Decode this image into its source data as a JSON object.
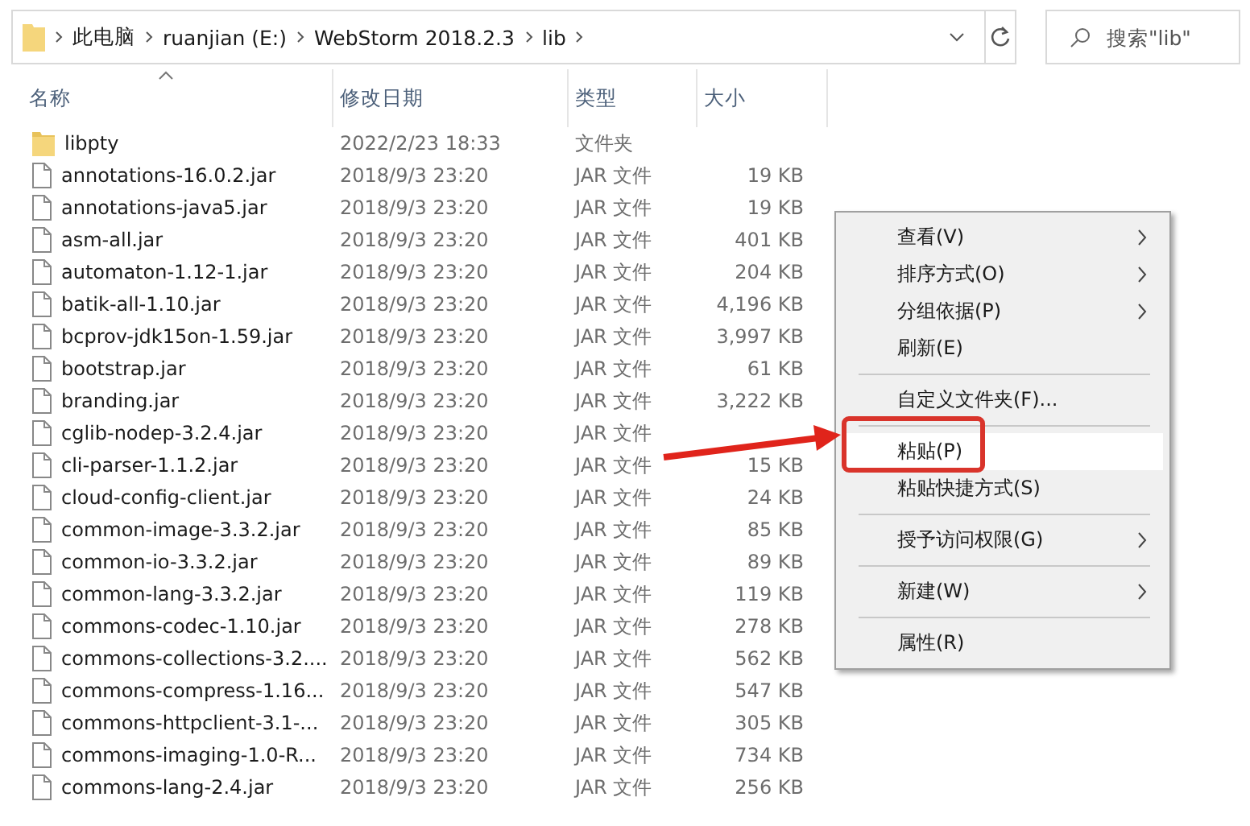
{
  "address_bar": {
    "crumbs": [
      "此电脑",
      "ruanjian (E:)",
      "WebStorm 2018.2.3",
      "lib"
    ]
  },
  "search": {
    "placeholder": "搜索\"lib\""
  },
  "columns": [
    {
      "label": "名称",
      "sorted": true
    },
    {
      "label": "修改日期",
      "sorted": false
    },
    {
      "label": "类型",
      "sorted": false
    },
    {
      "label": "大小",
      "sorted": false
    }
  ],
  "files": [
    {
      "kind": "folder",
      "name": "libpty",
      "date": "2022/2/23 18:33",
      "type": "文件夹"
    },
    {
      "kind": "file",
      "name": "annotations-16.0.2.jar",
      "date": "2018/9/3 23:20",
      "type": "JAR 文件",
      "size": "19 KB"
    },
    {
      "kind": "file",
      "name": "annotations-java5.jar",
      "date": "2018/9/3 23:20",
      "type": "JAR 文件",
      "size": "19 KB"
    },
    {
      "kind": "file",
      "name": "asm-all.jar",
      "date": "2018/9/3 23:20",
      "type": "JAR 文件",
      "size": "401 KB"
    },
    {
      "kind": "file",
      "name": "automaton-1.12-1.jar",
      "date": "2018/9/3 23:20",
      "type": "JAR 文件",
      "size": "204 KB"
    },
    {
      "kind": "file",
      "name": "batik-all-1.10.jar",
      "date": "2018/9/3 23:20",
      "type": "JAR 文件",
      "size": "4,196 KB"
    },
    {
      "kind": "file",
      "name": "bcprov-jdk15on-1.59.jar",
      "date": "2018/9/3 23:20",
      "type": "JAR 文件",
      "size": "3,997 KB"
    },
    {
      "kind": "file",
      "name": "bootstrap.jar",
      "date": "2018/9/3 23:20",
      "type": "JAR 文件",
      "size": "61 KB"
    },
    {
      "kind": "file",
      "name": "branding.jar",
      "date": "2018/9/3 23:20",
      "type": "JAR 文件",
      "size": "3,222 KB"
    },
    {
      "kind": "file",
      "name": "cglib-nodep-3.2.4.jar",
      "date": "2018/9/3 23:20",
      "type": "JAR 文件"
    },
    {
      "kind": "file",
      "name": "cli-parser-1.1.2.jar",
      "date": "2018/9/3 23:20",
      "type": "JAR 文件",
      "size": "15 KB"
    },
    {
      "kind": "file",
      "name": "cloud-config-client.jar",
      "date": "2018/9/3 23:20",
      "type": "JAR 文件",
      "size": "24 KB"
    },
    {
      "kind": "file",
      "name": "common-image-3.3.2.jar",
      "date": "2018/9/3 23:20",
      "type": "JAR 文件",
      "size": "85 KB"
    },
    {
      "kind": "file",
      "name": "common-io-3.3.2.jar",
      "date": "2018/9/3 23:20",
      "type": "JAR 文件",
      "size": "89 KB"
    },
    {
      "kind": "file",
      "name": "common-lang-3.3.2.jar",
      "date": "2018/9/3 23:20",
      "type": "JAR 文件",
      "size": "119 KB"
    },
    {
      "kind": "file",
      "name": "commons-codec-1.10.jar",
      "date": "2018/9/3 23:20",
      "type": "JAR 文件",
      "size": "278 KB"
    },
    {
      "kind": "file",
      "name": "commons-collections-3.2....",
      "date": "2018/9/3 23:20",
      "type": "JAR 文件",
      "size": "562 KB"
    },
    {
      "kind": "file",
      "name": "commons-compress-1.16...",
      "date": "2018/9/3 23:20",
      "type": "JAR 文件",
      "size": "547 KB"
    },
    {
      "kind": "file",
      "name": "commons-httpclient-3.1-...",
      "date": "2018/9/3 23:20",
      "type": "JAR 文件",
      "size": "305 KB"
    },
    {
      "kind": "file",
      "name": "commons-imaging-1.0-R...",
      "date": "2018/9/3 23:20",
      "type": "JAR 文件",
      "size": "734 KB"
    },
    {
      "kind": "file",
      "name": "commons-lang-2.4.jar",
      "date": "2018/9/3 23:20",
      "type": "JAR 文件",
      "size": "256 KB"
    }
  ],
  "context_menu": [
    {
      "kind": "item",
      "label": "查看(V)",
      "submenu": true,
      "highlighted": false
    },
    {
      "kind": "item",
      "label": "排序方式(O)",
      "submenu": true,
      "highlighted": false
    },
    {
      "kind": "item",
      "label": "分组依据(P)",
      "submenu": true,
      "highlighted": false
    },
    {
      "kind": "item",
      "label": "刷新(E)",
      "submenu": false,
      "highlighted": false
    },
    {
      "kind": "separator"
    },
    {
      "kind": "item",
      "label": "自定义文件夹(F)...",
      "submenu": false,
      "highlighted": false
    },
    {
      "kind": "separator"
    },
    {
      "kind": "item",
      "label": "粘贴(P)",
      "submenu": false,
      "highlighted": true
    },
    {
      "kind": "item",
      "label": "粘贴快捷方式(S)",
      "submenu": false,
      "highlighted": false
    },
    {
      "kind": "separator"
    },
    {
      "kind": "item",
      "label": "授予访问权限(G)",
      "submenu": true,
      "highlighted": false
    },
    {
      "kind": "separator"
    },
    {
      "kind": "item",
      "label": "新建(W)",
      "submenu": true,
      "highlighted": false
    },
    {
      "kind": "separator"
    },
    {
      "kind": "item",
      "label": "属性(R)",
      "submenu": false,
      "highlighted": false
    }
  ]
}
